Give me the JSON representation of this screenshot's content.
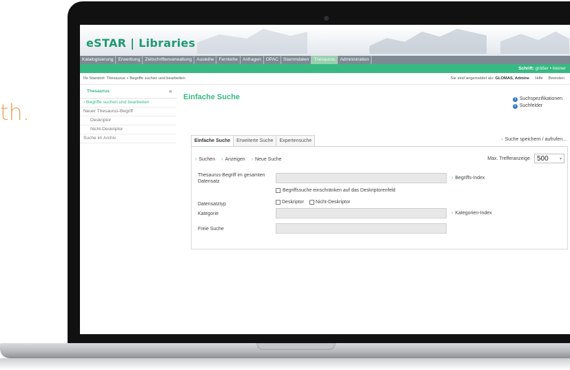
{
  "side_text": "th.",
  "app": {
    "brand": "eSTAR | Libraries",
    "menu": [
      "Katalogisierung",
      "Erwerbung",
      "Zeitschriftenverwaltung",
      "Ausleihe",
      "Fernleihe",
      "Anfragen",
      "OPAC",
      "Stammdaten",
      "Thesaurus",
      "Administration"
    ],
    "active_menu": "Thesaurus",
    "font_size_label": "Schrift:",
    "font_size_options": "größer • kleiner",
    "breadcrumb": "Ihr Standort: Thesaurus » Begriffe suchen und bearbeiten",
    "user_prefix": "Sie sind angemeldet als:",
    "user_name": "GLOMAS, Admine",
    "help": "Hilfe",
    "logout": "Beenden"
  },
  "sidebar": {
    "title": "Thesaurus",
    "collapse": "«",
    "items": [
      {
        "label": "Begriffe suchen und bearbeiten"
      },
      {
        "label": "Neuer Thesaurus-Begriff"
      },
      {
        "label": "Deskriptor"
      },
      {
        "label": "Nicht-Deskriptor"
      },
      {
        "label": "Suche im Archiv"
      }
    ]
  },
  "main": {
    "title": "Einfache Suche",
    "help_links": [
      "Suchspezifikationen",
      "Suchfelder"
    ],
    "tabs": [
      "Einfache Suche",
      "Erweiterte Suche",
      "Expertensuche"
    ],
    "save_link": "Suche speichern / aufrufen...",
    "actions": [
      "Suchen",
      "Anzeigen",
      "Neue Suche"
    ],
    "max_hits_label": "Max. Trefferanzeige",
    "max_hits_value": "500",
    "fields": {
      "thesaurus_label": "Thesaurus-Begriff im gesamten Datensatz",
      "thesaurus_value": "",
      "begriffs_index": "Begriffs-Index",
      "restrict_checkbox": "Begriffssuche einschränken auf das Deskriptorenfeld",
      "datensatztyp_label": "Datensatztyp",
      "type_options": [
        "Deskriptor",
        "Nicht-Deskriptor"
      ],
      "kategorie_label": "Kategorie",
      "kategorie_value": "",
      "kategorien_index": "Kategorien-Index",
      "freie_suche_label": "Freie Suche",
      "freie_suche_value": ""
    }
  },
  "colors": {
    "brand_green": "#38b983",
    "menu_gray": "#7d8a93",
    "side_text_orange": "#e8a35a"
  }
}
